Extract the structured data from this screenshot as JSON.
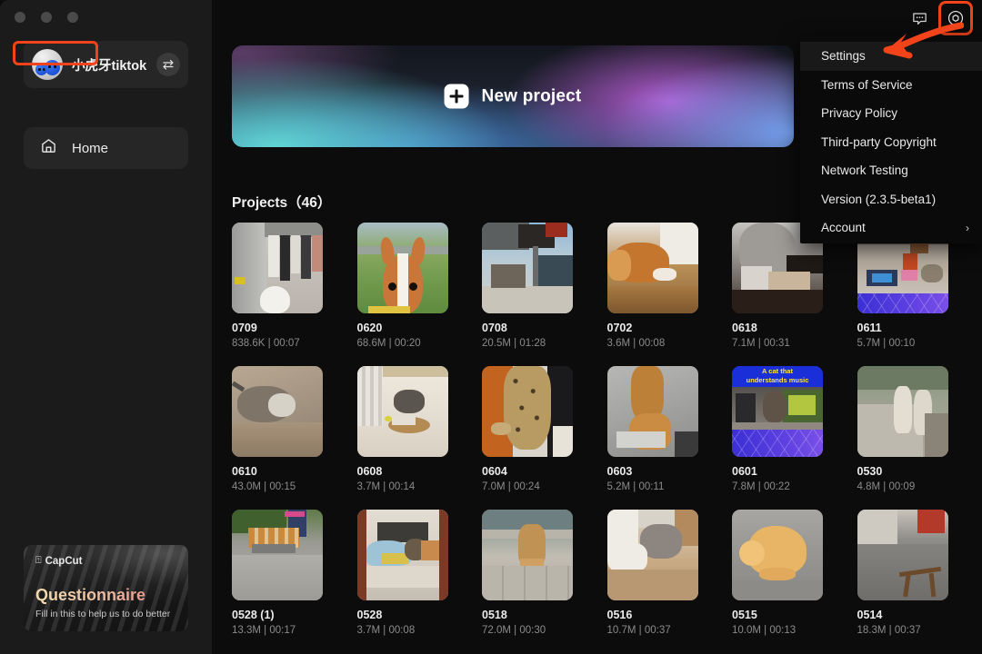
{
  "window": {
    "traffic_lights": [
      "close",
      "minimize",
      "maximize"
    ]
  },
  "sidebar": {
    "profile": {
      "name": "小虎牙tiktok",
      "switch_icon": "switch-account-icon"
    },
    "nav": [
      {
        "label": "Home",
        "icon": "home-icon",
        "active": true
      }
    ],
    "promo": {
      "brand": "CapCut",
      "title": "Questionnaire",
      "subtitle": "Fill in this to help us to do better"
    }
  },
  "topbar": {
    "icons": [
      {
        "name": "feedback-icon"
      },
      {
        "name": "gear-icon",
        "highlighted": true
      }
    ]
  },
  "banner": {
    "label": "New project",
    "icon": "plus-icon"
  },
  "projects_section": {
    "title": "Projects（46）",
    "count": 46
  },
  "menu": {
    "items": [
      {
        "label": "Settings",
        "highlighted": true,
        "has_submenu": false
      },
      {
        "label": "Terms of Service",
        "highlighted": false,
        "has_submenu": false
      },
      {
        "label": "Privacy Policy",
        "highlighted": false,
        "has_submenu": false
      },
      {
        "label": "Third-party Copyright",
        "highlighted": false,
        "has_submenu": false
      },
      {
        "label": "Network Testing",
        "highlighted": false,
        "has_submenu": false
      },
      {
        "label": "Version (2.3.5-beta1)",
        "highlighted": false,
        "has_submenu": false
      },
      {
        "label": "Account",
        "highlighted": false,
        "has_submenu": true,
        "chevron": "›"
      }
    ]
  },
  "annotation": {
    "color": "#f2431b",
    "target": "Settings",
    "arrow": "pointer-arrow"
  },
  "projects": [
    {
      "name": "0709",
      "size": "838.6K",
      "duration": "00:07",
      "meta": "838.6K | 00:07"
    },
    {
      "name": "0620",
      "size": "68.6M",
      "duration": "00:20",
      "meta": "68.6M | 00:20"
    },
    {
      "name": "0708",
      "size": "20.5M",
      "duration": "01:28",
      "meta": "20.5M | 01:28"
    },
    {
      "name": "0702",
      "size": "3.6M",
      "duration": "00:08",
      "meta": "3.6M | 00:08"
    },
    {
      "name": "0618",
      "size": "7.1M",
      "duration": "00:31",
      "meta": "7.1M | 00:31"
    },
    {
      "name": "0611",
      "size": "5.7M",
      "duration": "00:10",
      "meta": "5.7M | 00:10"
    },
    {
      "name": "0610",
      "size": "43.0M",
      "duration": "00:15",
      "meta": "43.0M | 00:15"
    },
    {
      "name": "0608",
      "size": "3.7M",
      "duration": "00:14",
      "meta": "3.7M | 00:14"
    },
    {
      "name": "0604",
      "size": "7.0M",
      "duration": "00:24",
      "meta": "7.0M | 00:24"
    },
    {
      "name": "0603",
      "size": "5.2M",
      "duration": "00:11",
      "meta": "5.2M | 00:11"
    },
    {
      "name": "0601",
      "size": "7.8M",
      "duration": "00:22",
      "meta": "7.8M | 00:22",
      "caption": "A cat that understands music"
    },
    {
      "name": "0530",
      "size": "4.8M",
      "duration": "00:09",
      "meta": "4.8M | 00:09"
    },
    {
      "name": "0528 (1)",
      "size": "13.3M",
      "duration": "00:17",
      "meta": "13.3M | 00:17"
    },
    {
      "name": "0528",
      "size": "3.7M",
      "duration": "00:08",
      "meta": "3.7M | 00:08"
    },
    {
      "name": "0518",
      "size": "72.0M",
      "duration": "00:30",
      "meta": "72.0M | 00:30"
    },
    {
      "name": "0516",
      "size": "10.7M",
      "duration": "00:37",
      "meta": "10.7M | 00:37"
    },
    {
      "name": "0515",
      "size": "10.0M",
      "duration": "00:13",
      "meta": "10.0M | 00:13"
    },
    {
      "name": "0514",
      "size": "18.3M",
      "duration": "00:37",
      "meta": "18.3M | 00:37"
    }
  ]
}
